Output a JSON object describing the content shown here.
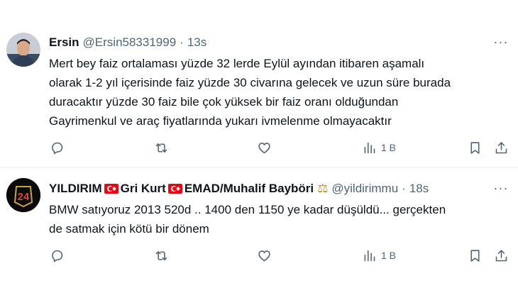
{
  "tweets": [
    {
      "author_name": "Ersin",
      "handle": "@Ersin58331999",
      "separator": "·",
      "time": "13s",
      "more": "···",
      "text": "Mert bey faiz ortalaması yüzde 32 lerde Eylül ayından itibaren aşamalı\nolarak 1-2 yıl içerisinde faiz yüzde 30 civarına gelecek ve uzun süre burada\nduracaktır yüzde 30 faiz bile çok yüksek bir faiz oranı olduğundan\nGayrimenkul ve araç fiyatlarında yukarı ivmelenme olmayacaktır",
      "views": "1 B",
      "avatar_icon": "person-photo"
    },
    {
      "author_name_part1": "YILDIRIM",
      "author_name_part2": "Gri Kurt",
      "author_name_part3": "EMAD/Muhalif Bayböri",
      "handle": "@yildirimmu",
      "separator": "·",
      "time": "18s",
      "more": "···",
      "text": "BMW satıyoruz 2013 520d .. 1400 den 1150 ye kadar düşüldü... gerçekten\nde satmak için kötü bir dönem",
      "views": "1 B",
      "avatar_badge_text": "24",
      "flag_icon": "turkey-flag",
      "badge_icon": "scales-icon"
    }
  ],
  "colors": {
    "text": "#0f1419",
    "muted": "#536471",
    "divider": "#eff3f4",
    "flag_red": "#e30a17"
  }
}
